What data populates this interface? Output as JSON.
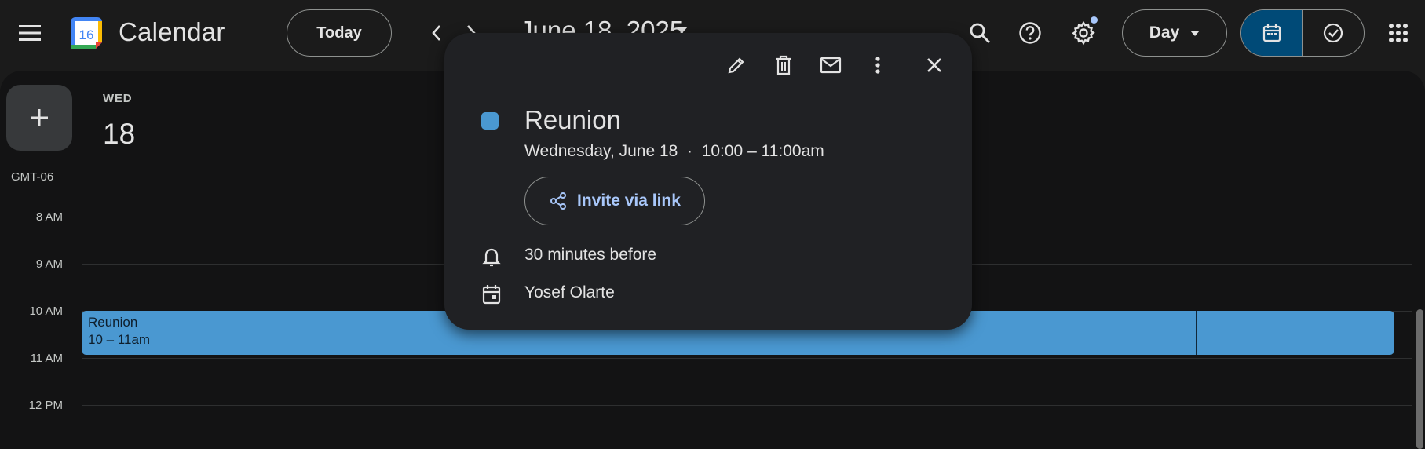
{
  "header": {
    "app_title": "Calendar",
    "logo_number": "16",
    "today_label": "Today",
    "date_title": "June 18, 2025",
    "view_label": "Day"
  },
  "day": {
    "weekday": "WED",
    "date": "18",
    "timezone": "GMT-06"
  },
  "hours": [
    "8 AM",
    "9 AM",
    "10 AM",
    "11 AM",
    "12 PM"
  ],
  "event": {
    "title": "Reunion",
    "time": "10 – 11am",
    "color": "#4a98d1"
  },
  "popup": {
    "title": "Reunion",
    "when": "Wednesday, June 18  ·  10:00 – 11:00am",
    "invite_label": "Invite via link",
    "reminder": "30 minutes before",
    "calendar_owner": "Yosef Olarte"
  },
  "colors": {
    "accent": "#a8c7fa",
    "selected_view": "#004a77",
    "event": "#4a98d1"
  }
}
